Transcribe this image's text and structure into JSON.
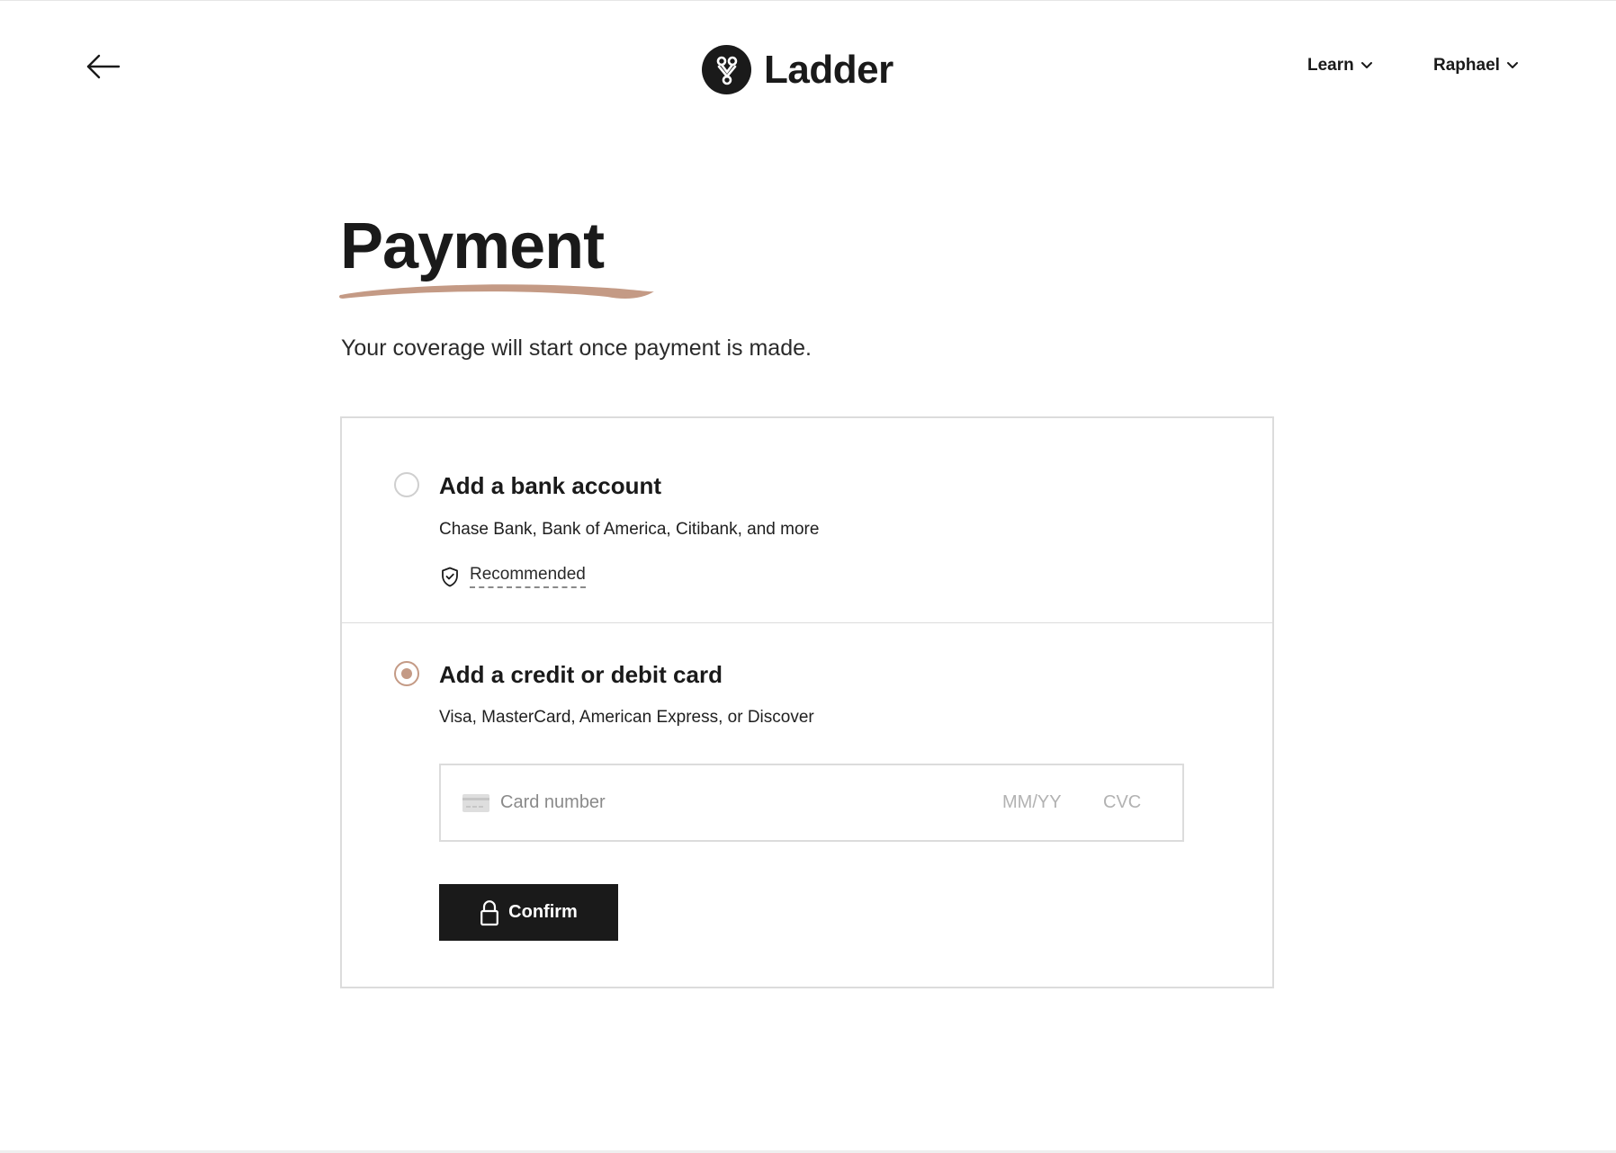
{
  "header": {
    "back_icon": "arrow-left-icon",
    "brand": "Ladder",
    "logo_icon": "ladder-logo-icon",
    "nav": [
      {
        "label": "Learn",
        "icon": "chevron-down-icon"
      },
      {
        "label": "Raphael",
        "icon": "chevron-down-icon"
      }
    ]
  },
  "page": {
    "title": "Payment",
    "subtitle": "Your coverage will start once payment is made.",
    "accent_color": "#c49a85"
  },
  "options": {
    "bank": {
      "title": "Add a bank account",
      "description": "Chase Bank, Bank of America, Citibank, and more",
      "badge": "Recommended",
      "badge_icon": "shield-check-icon",
      "selected": false
    },
    "card": {
      "title": "Add a credit or debit card",
      "description": "Visa, MasterCard, American Express, or Discover",
      "selected": true,
      "fields": {
        "number_placeholder": "Card number",
        "expiry_placeholder": "MM/YY",
        "cvc_placeholder": "CVC"
      },
      "confirm_label": "Confirm",
      "confirm_icon": "lock-icon"
    }
  }
}
